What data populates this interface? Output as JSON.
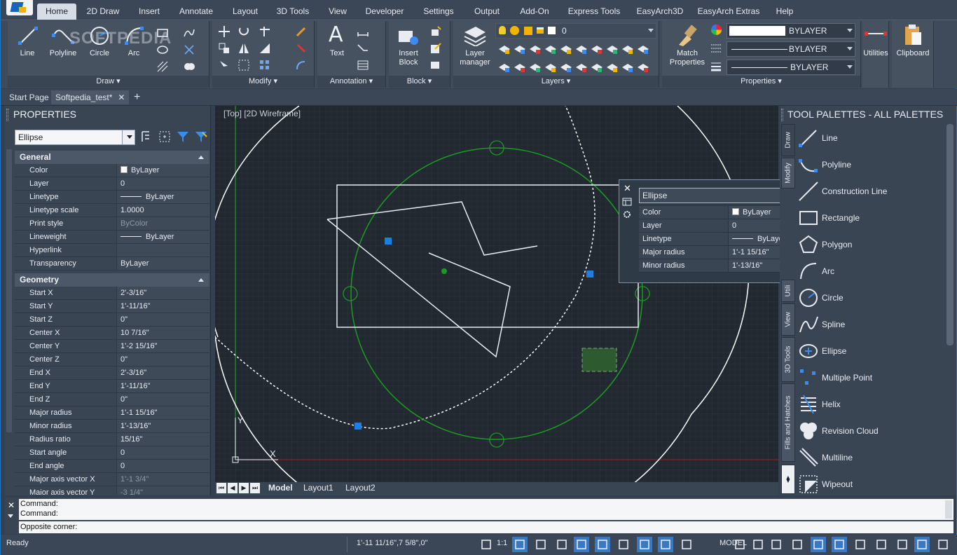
{
  "tabs": [
    "Home",
    "2D Draw",
    "Insert",
    "Annotate",
    "Layout",
    "3D Tools",
    "View",
    "Developer",
    "Settings",
    "Output",
    "Add-On",
    "Express Tools",
    "EasyArch3D",
    "EasyArch Extras",
    "Help"
  ],
  "ribbon": {
    "draw": {
      "label": "Draw",
      "buttons": [
        "Line",
        "Polyline",
        "Circle",
        "Arc"
      ]
    },
    "modify": {
      "label": "Modify"
    },
    "annotation": {
      "label": "Annotation",
      "text": "Text"
    },
    "block": {
      "label": "Block",
      "insert": "Insert\nBlock",
      "insert1": "Insert",
      "insert2": "Block"
    },
    "layers": {
      "label": "Layers",
      "manager1": "Layer",
      "manager2": "manager",
      "current": "0"
    },
    "match": {
      "l1": "Match",
      "l2": "Properties"
    },
    "properties": {
      "label": "Properties",
      "color": "BYLAYER",
      "linetype": "BYLAYER",
      "lineweight": "BYLAYER"
    },
    "utilities": "Utilities",
    "clipboard": "Clipboard"
  },
  "watermark": "SOFTPEDIA",
  "doctabs": {
    "start": "Start Page",
    "file": "Softpedia_test*"
  },
  "properties": {
    "title": "PROPERTIES",
    "selector": "Ellipse",
    "general_header": "General",
    "general": [
      {
        "name": "Color",
        "value": "ByLayer",
        "swatch": true
      },
      {
        "name": "Layer",
        "value": "0"
      },
      {
        "name": "Linetype",
        "value": "ByLayer",
        "line": true
      },
      {
        "name": "Linetype scale",
        "value": "1.0000"
      },
      {
        "name": "Print style",
        "value": "ByColor",
        "dim": true
      },
      {
        "name": "Lineweight",
        "value": "ByLayer",
        "line": true
      },
      {
        "name": "Hyperlink",
        "value": ""
      },
      {
        "name": "Transparency",
        "value": "ByLayer"
      }
    ],
    "geometry_header": "Geometry",
    "geometry": [
      {
        "name": "Start X",
        "value": "2'-3/16\""
      },
      {
        "name": "Start Y",
        "value": "1'-11/16\""
      },
      {
        "name": "Start Z",
        "value": "0\""
      },
      {
        "name": "Center X",
        "value": "10 7/16\""
      },
      {
        "name": "Center Y",
        "value": "1'-2 15/16\""
      },
      {
        "name": "Center Z",
        "value": "0\""
      },
      {
        "name": "End X",
        "value": "2'-3/16\""
      },
      {
        "name": "End Y",
        "value": "1'-11/16\""
      },
      {
        "name": "End Z",
        "value": "0\""
      },
      {
        "name": "Major radius",
        "value": "1'-1 15/16\""
      },
      {
        "name": "Minor radius",
        "value": "1'-13/16\""
      },
      {
        "name": "Radius ratio",
        "value": "15/16\""
      },
      {
        "name": "Start angle",
        "value": "0"
      },
      {
        "name": "End angle",
        "value": "0"
      },
      {
        "name": "Major axis vector X",
        "value": "1'-1 3/4\"",
        "dim": true
      },
      {
        "name": "Major axis vector Y",
        "value": "-3 1/4\"",
        "dim": true
      }
    ]
  },
  "viewport": {
    "label": "[Top] [2D Wireframe]",
    "axis_y": "Y",
    "axis_x": "X"
  },
  "layout_tabs": [
    "Model",
    "Layout1",
    "Layout2"
  ],
  "quickprops": {
    "selector": "Ellipse",
    "rows": [
      {
        "name": "Color",
        "value": "ByLayer",
        "swatch": true
      },
      {
        "name": "Layer",
        "value": "0"
      },
      {
        "name": "Linetype",
        "value": "ByLayer",
        "line": true
      },
      {
        "name": "Major radius",
        "value": "1'-1 15/16\""
      },
      {
        "name": "Minor radius",
        "value": "1'-13/16\""
      }
    ]
  },
  "tool_palettes": {
    "title": "TOOL PALETTES - ALL PALETTES",
    "vtabs": [
      "Draw",
      "Modify",
      "Utili",
      "View",
      "3D Tools",
      "Fills and Hatches"
    ],
    "items": [
      "Line",
      "Polyline",
      "Construction Line",
      "Rectangle",
      "Polygon",
      "Arc",
      "Circle",
      "Spline",
      "Ellipse",
      "Multiple Point",
      "Helix",
      "Revision Cloud",
      "Multiline",
      "Wipeout"
    ]
  },
  "command": {
    "lines": [
      "Command:",
      "Command:"
    ],
    "prompt": "Opposite corner:"
  },
  "status": {
    "ready": "Ready",
    "coords": "1'-11 11/16\",7 5/8\",0\"",
    "scale": "1:1",
    "model": "MODEL"
  },
  "colors": {
    "accent": "#3979c4",
    "green": "#1e9a23",
    "canvas": "#212830"
  }
}
